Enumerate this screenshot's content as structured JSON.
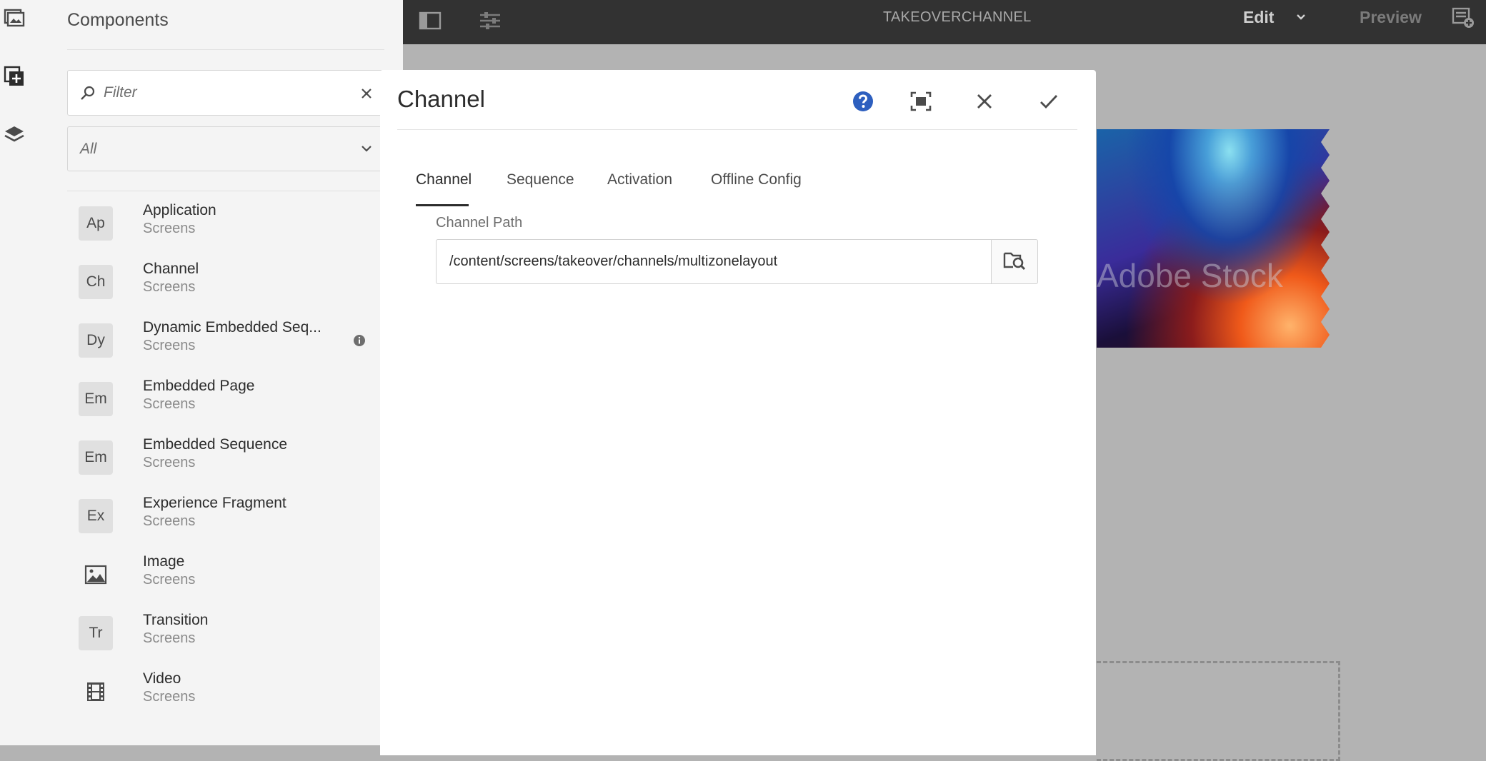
{
  "rail": {
    "icons": [
      "assets-icon",
      "components-icon",
      "layers-icon"
    ]
  },
  "panel": {
    "title": "Components",
    "filter": {
      "placeholder": "Filter"
    },
    "group_select": {
      "value": "All"
    },
    "items": [
      {
        "badge": "Ap",
        "name": "Application",
        "group": "Screens"
      },
      {
        "badge": "Ch",
        "name": "Channel",
        "group": "Screens"
      },
      {
        "badge": "Dy",
        "name": "Dynamic Embedded Seq...",
        "group": "Screens"
      },
      {
        "badge": "Em",
        "name": "Embedded Page",
        "group": "Screens"
      },
      {
        "badge": "Em",
        "name": "Embedded Sequence",
        "group": "Screens"
      },
      {
        "badge": "Ex",
        "name": "Experience Fragment",
        "group": "Screens"
      },
      {
        "badge": "",
        "name": "Image",
        "group": "Screens"
      },
      {
        "badge": "Tr",
        "name": "Transition",
        "group": "Screens"
      },
      {
        "badge": "",
        "name": "Video",
        "group": "Screens"
      }
    ]
  },
  "topbar": {
    "title": "TAKEOVERCHANNEL",
    "mode": "Edit",
    "preview": "Preview"
  },
  "canvas": {
    "watermark": "Adobe Stock"
  },
  "dialog": {
    "title": "Channel",
    "tabs": [
      "Channel",
      "Sequence",
      "Activation",
      "Offline Config"
    ],
    "active_tab": "Channel",
    "field": {
      "label": "Channel Path",
      "value": "/content/screens/takeover/channels/multizonelayout"
    }
  },
  "colors": {
    "topbar_bg": "#323232",
    "help_blue": "#2d5fbf",
    "panel_bg": "#f4f4f4"
  }
}
